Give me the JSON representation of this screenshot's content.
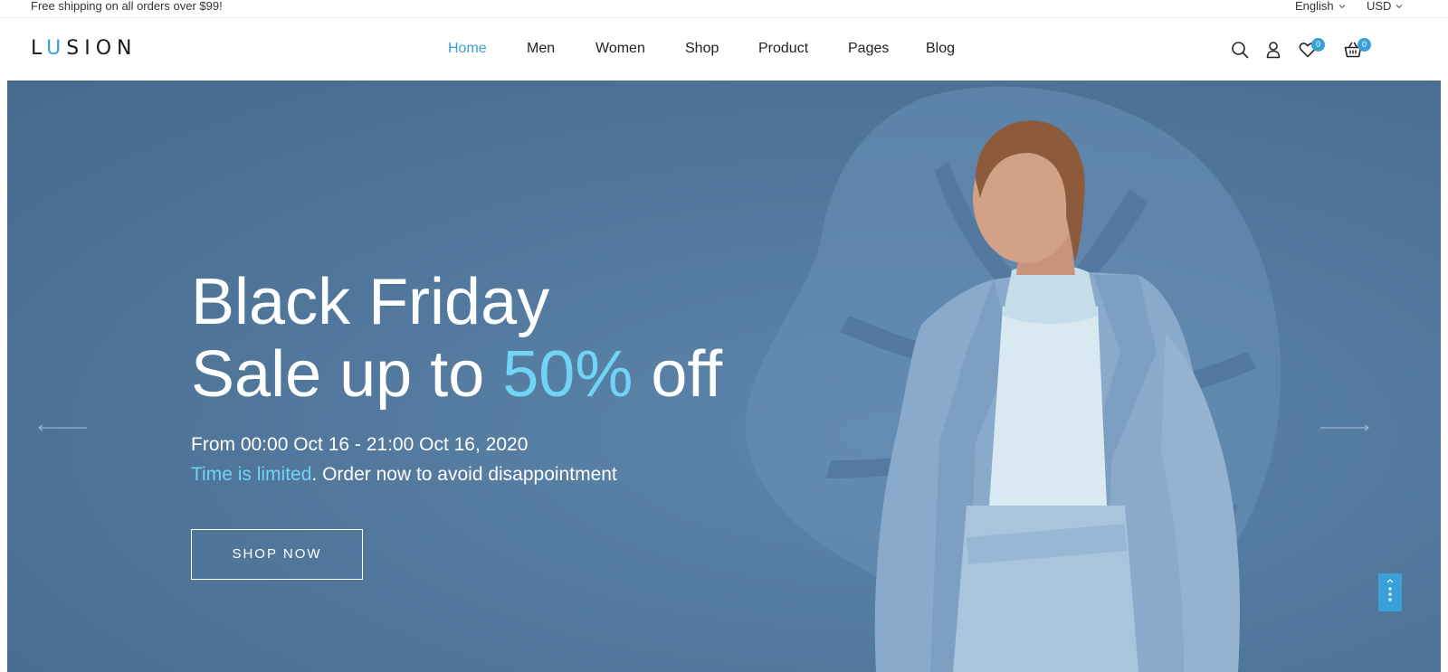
{
  "topbar": {
    "promo": "Free shipping on all orders over $99!",
    "language": "English",
    "currency": "USD"
  },
  "header": {
    "logo_l": "L",
    "logo_u": "U",
    "logo_rest": "SION",
    "nav": [
      {
        "label": "Home",
        "active": true
      },
      {
        "label": "Men"
      },
      {
        "label": "Women"
      },
      {
        "label": "Shop"
      },
      {
        "label": "Product"
      },
      {
        "label": "Pages"
      },
      {
        "label": "Blog"
      }
    ],
    "icons": {
      "search": "search-icon",
      "account": "user-icon",
      "wishlist": "heart-icon",
      "cart": "basket-icon"
    },
    "wishlist_count": "0",
    "cart_count": "0"
  },
  "hero": {
    "title_line1": "Black Friday",
    "title_line2_a": "Sale up to ",
    "title_line2_highlight": "50%",
    "title_line2_b": " off",
    "date_range": "From 00:00 Oct 16 - 21:00 Oct 16, 2020",
    "limited_highlight": "Time is limited",
    "limited_rest": ". Order now to avoid disappointment",
    "cta_label": "SHOP NOW"
  },
  "colors": {
    "accent": "#3aa0d8",
    "highlight": "#6fd4f5",
    "hero_bg": "#52789d"
  }
}
